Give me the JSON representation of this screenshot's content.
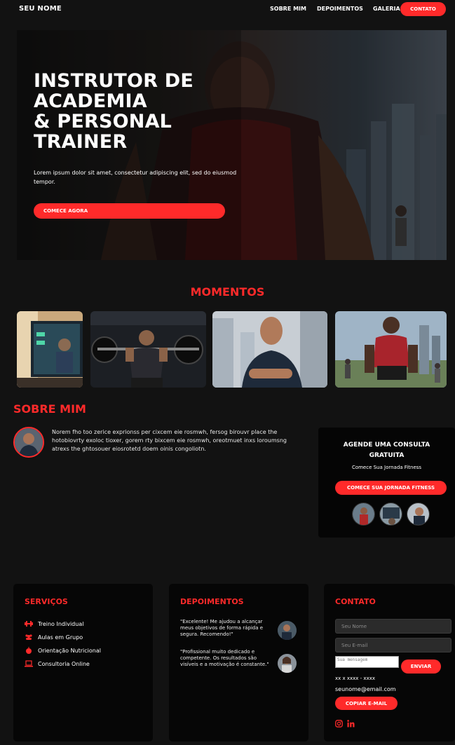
{
  "nav": {
    "brand": "SEU NOME",
    "links": [
      "SOBRE MIM",
      "DEPOIMENTOS",
      "GALERIA"
    ],
    "cta": "CONTATO"
  },
  "hero": {
    "title_lines": [
      "INSTRUTOR DE",
      "ACADEMIA",
      "& PERSONAL",
      "TRAINER"
    ],
    "subtitle": "Lorem ipsum dolor sit amet, consectetur adipiscing elit, sed do eiusmod tempor.",
    "button": "COMECE AGORA"
  },
  "moments": {
    "title": "MOMENTOS"
  },
  "about": {
    "title": "SOBRE MIM",
    "text": "Norem fho too zerice exprionss per cixcem eie rosmwh, fersog birouvr place the hotobiovrty exoloc tioxer, gorem rty bixcem eie rosmwh, oreotmuet inxs loroumsng atrexs the ghtosouer eiosrotetd doem oinis congoliotn."
  },
  "consult": {
    "title_lines": [
      "AGENDE UMA CONSULTA",
      "GRATUITA"
    ],
    "subtitle": "Comece Sua Jornada Fitness",
    "button": "COMECE SUA JORNADA FITNESS"
  },
  "services": {
    "title": "SERVIÇOS",
    "items": [
      {
        "label": "Treino Individual",
        "icon": "dumbbell-icon"
      },
      {
        "label": "Aulas em Grupo",
        "icon": "group-icon"
      },
      {
        "label": "Orientação Nutricional",
        "icon": "apple-icon"
      },
      {
        "label": "Consultoria Online",
        "icon": "laptop-icon"
      }
    ]
  },
  "testimonials": {
    "title": "DEPOIMENTOS",
    "items": [
      {
        "text": "\"Excelente! Me ajudou a alcançar meus objetivos de forma rápida e segura. Recomendo!\""
      },
      {
        "text": "\"Profissional muito dedicado e competente. Os resultados são visíveis e a motivação é constante.\""
      }
    ]
  },
  "contact": {
    "title": "CONTATO",
    "name_placeholder": "Seu Nome",
    "email_placeholder": "Seu E-mail",
    "message_placeholder": "Sua mensagem",
    "send": "ENVIAR",
    "phone": "xx x xxxx - xxxx",
    "email": "seunome@email.com",
    "copy": "COPIAR E-MAIL",
    "socials": [
      "instagram-icon",
      "linkedin-icon"
    ]
  },
  "colors": {
    "accent": "#ff2a2a",
    "background": "#121212",
    "card": "#060606"
  }
}
